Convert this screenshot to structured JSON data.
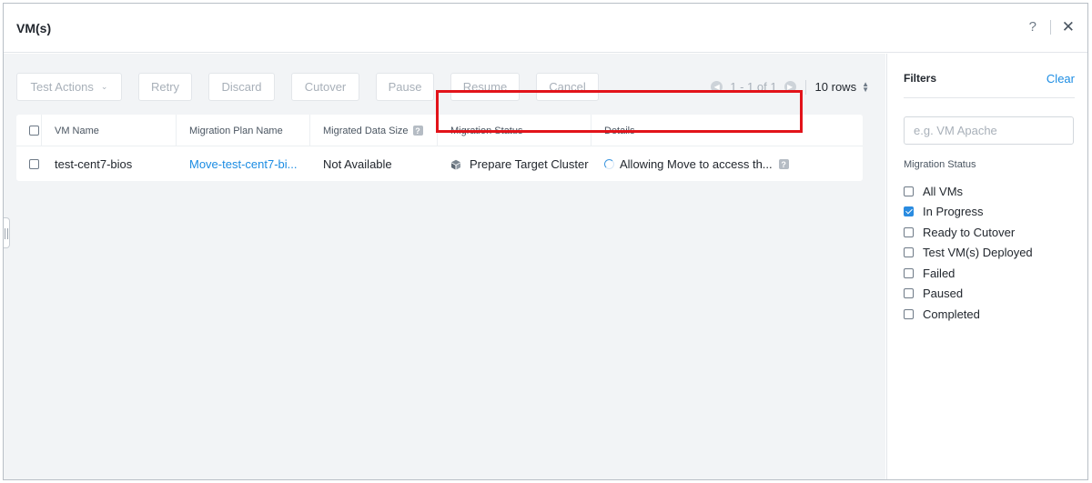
{
  "dialog": {
    "title": "VM(s)",
    "help_glyph": "?",
    "close_glyph": "✕"
  },
  "toolbar": {
    "buttons": [
      {
        "label": "Test Actions",
        "has_dropdown": true
      },
      {
        "label": "Retry"
      },
      {
        "label": "Discard"
      },
      {
        "label": "Cutover"
      },
      {
        "label": "Pause"
      },
      {
        "label": "Resume"
      },
      {
        "label": "Cancel"
      }
    ],
    "pagination": {
      "range": "1 - 1 of 1",
      "rows_per_page": "10 rows"
    }
  },
  "table": {
    "columns": [
      "VM Name",
      "Migration Plan Name",
      "Migrated Data Size",
      "Migration Status",
      "Details"
    ],
    "rows": [
      {
        "vm_name": "test-cent7-bios",
        "migration_plan": "Move-test-cent7-bi...",
        "data_size": "Not Available",
        "status": "Prepare Target Cluster",
        "details": "Allowing Move to access th..."
      }
    ]
  },
  "filters": {
    "title": "Filters",
    "clear_label": "Clear",
    "search_placeholder": "e.g. VM Apache",
    "section_label": "Migration Status",
    "options": [
      {
        "label": "All VMs",
        "checked": false
      },
      {
        "label": "In Progress",
        "checked": true
      },
      {
        "label": "Ready to Cutover",
        "checked": false
      },
      {
        "label": "Test VM(s) Deployed",
        "checked": false
      },
      {
        "label": "Failed",
        "checked": false
      },
      {
        "label": "Paused",
        "checked": false
      },
      {
        "label": "Completed",
        "checked": false
      }
    ]
  },
  "colors": {
    "accent": "#1b8ce3",
    "highlight_box": "#e2131a",
    "background": "#f2f4f6"
  }
}
